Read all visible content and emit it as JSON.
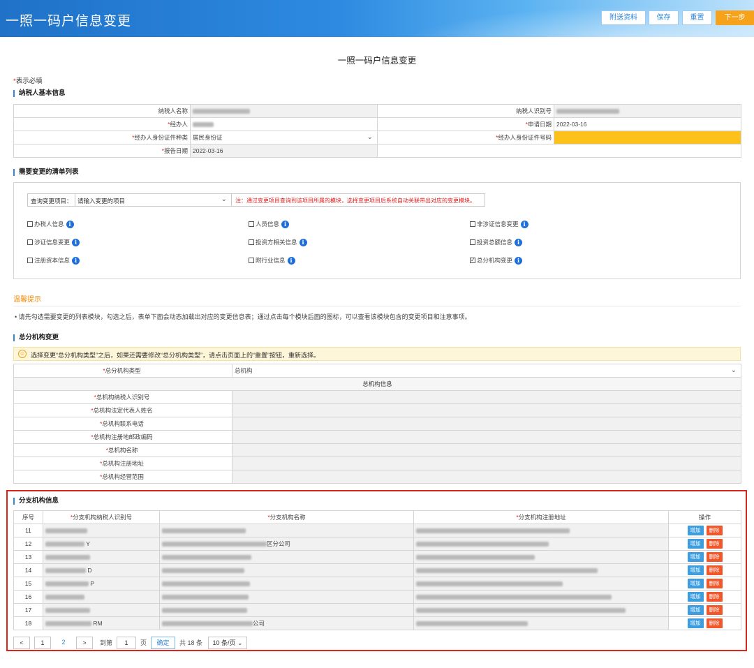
{
  "header": {
    "title": "一照一码户信息变更",
    "buttons": {
      "attach": "附送资料",
      "save": "保存",
      "reset": "重置",
      "next": "下一步"
    }
  },
  "page_title": "一照一码户信息变更",
  "required_note": "表示必填",
  "sections": {
    "basic": "纳税人基本信息",
    "change_list": "需要变更的清单列表",
    "hq": "总分机构变更",
    "branch": "分支机构信息"
  },
  "basic_info": {
    "taxpayer_name_label": "纳税人名称",
    "taxpayer_id_label": "纳税人识别号",
    "agent_label": "经办人",
    "apply_date_label": "申请日期",
    "apply_date": "2022-03-16",
    "id_type_label": "经办人身份证件种类",
    "id_type": "居民身份证",
    "id_no_label": "经办人身份证件号码",
    "report_date_label": "报告日期",
    "report_date": "2022-03-16"
  },
  "query": {
    "label": "查询变更项目：",
    "placeholder": "请输入变更的项目",
    "note": "注：通过变更项目查询到该项目所属的模块，选择变更项目后系统自动关联带出对应的变更模块。"
  },
  "change_items": [
    {
      "label": "办税人信息",
      "checked": false
    },
    {
      "label": "人员信息",
      "checked": false
    },
    {
      "label": "非涉证信息变更",
      "checked": false
    },
    {
      "label": "涉证信息变更",
      "checked": false
    },
    {
      "label": "投资方相关信息",
      "checked": false
    },
    {
      "label": "投资总额信息",
      "checked": false
    },
    {
      "label": "注册资本信息",
      "checked": false
    },
    {
      "label": "附行业信息",
      "checked": false
    },
    {
      "label": "总分机构变更",
      "checked": true
    }
  ],
  "tip": {
    "title": "温馨提示",
    "text": "• 请先勾选需要变更的列表模块，勾选之后，表单下面会动态加载出对应的变更信息表；通过点击每个模块后面的图标，可以查看该模块包含的变更项目和注意事项。"
  },
  "warning": "选择变更“总分机构类型”之后，如果还需要修改“总分机构类型”，请点击页面上的“重置”按钮，重新选择。",
  "hq": {
    "type_label": "总分机构类型",
    "type_value": "总机构",
    "group_title": "总机构信息",
    "fields": [
      "总机构纳税人识别号",
      "总机构法定代表人姓名",
      "总机构联系电话",
      "总机构注册地邮政编码",
      "总机构名称",
      "总机构注册地址",
      "总机构经营范围"
    ]
  },
  "branch": {
    "headers": {
      "seq": "序号",
      "id": "分支机构纳税人识别号",
      "name": "分支机构名称",
      "addr": "分支机构注册地址",
      "ops": "操作"
    },
    "rows": [
      {
        "seq": "11",
        "id_tail": "",
        "name_tail": ""
      },
      {
        "seq": "12",
        "id_tail": "Y",
        "name_tail": "区分公司"
      },
      {
        "seq": "13",
        "id_tail": "",
        "name_tail": ""
      },
      {
        "seq": "14",
        "id_tail": "D",
        "name_tail": ""
      },
      {
        "seq": "15",
        "id_tail": "P",
        "name_tail": ""
      },
      {
        "seq": "16",
        "id_tail": "",
        "name_tail": ""
      },
      {
        "seq": "17",
        "id_tail": "",
        "name_tail": ""
      },
      {
        "seq": "18",
        "id_tail": "RM",
        "name_tail": "公司"
      }
    ],
    "add": "增加",
    "del": "删除"
  },
  "pager": {
    "prev": "<",
    "next": ">",
    "pages": [
      "1",
      "2"
    ],
    "goto": "到第",
    "goto_value": "1",
    "page_unit": "页",
    "confirm": "确定",
    "total": "共 18 条",
    "page_size": "10 条/页"
  }
}
